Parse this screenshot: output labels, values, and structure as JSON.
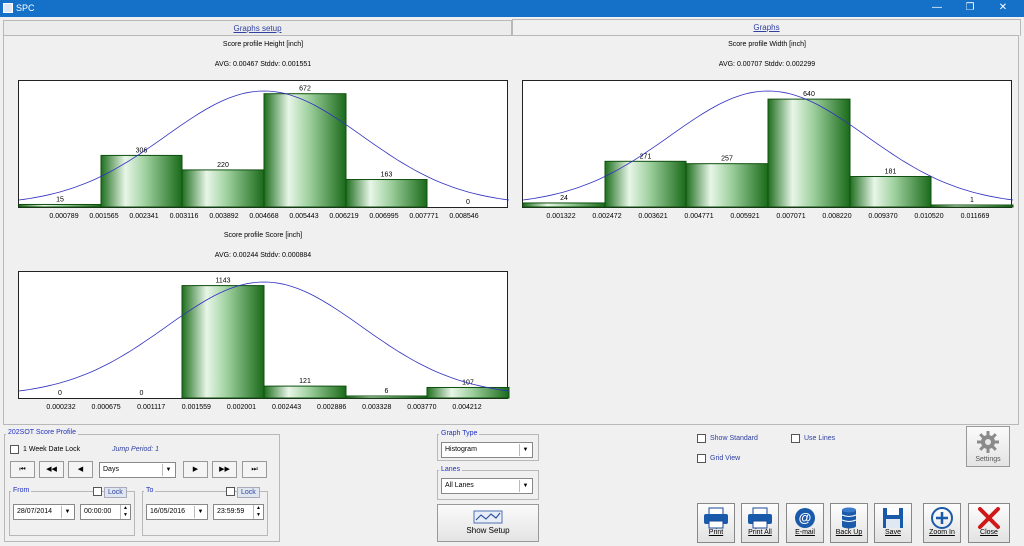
{
  "window": {
    "title": "SPC",
    "minimize": "—",
    "restore": "❐",
    "close": "✕"
  },
  "tabs": [
    {
      "label": "Graphs setup"
    },
    {
      "label": "Graphs"
    }
  ],
  "charts": [
    {
      "title": "Score profile Height  [inch]",
      "stats": "AVG: 0.00467 Stddv: 0.001551"
    },
    {
      "title": "Score profile Width  [inch]",
      "stats": "AVG: 0.00707 Stddv: 0.002299"
    },
    {
      "title": "Score profile Score  [inch]",
      "stats": "AVG: 0.00244 Stddv: 0.000884"
    }
  ],
  "chart_data": [
    {
      "type": "bar",
      "title": "Score profile Height  [inch]",
      "subtitle": "AVG: 0.00467 Stddv: 0.001551",
      "bin_edges": [
        "0.000789",
        "0.001565",
        "0.002341",
        "0.003116",
        "0.003892",
        "0.004668",
        "0.005443",
        "0.006219",
        "0.006995",
        "0.007771",
        "0.008546"
      ],
      "values": [
        15,
        306,
        220,
        672,
        163,
        0
      ],
      "bar_edges": [
        [
          "0.0000",
          "0.001565"
        ],
        [
          "0.001565",
          "0.003116"
        ],
        [
          "0.003116",
          "0.004668"
        ],
        [
          "0.004668",
          "0.006219"
        ],
        [
          "0.006219",
          "0.007771"
        ],
        [
          "0.007771",
          "0.008546"
        ]
      ],
      "normal_curve": {
        "mean": 0.00467,
        "stddev": 0.001551
      },
      "ylim": [
        0,
        700
      ]
    },
    {
      "type": "bar",
      "title": "Score profile Width  [inch]",
      "subtitle": "AVG: 0.00707 Stddv: 0.002299",
      "bin_edges": [
        "0.001322",
        "0.002472",
        "0.003621",
        "0.004771",
        "0.005921",
        "0.007071",
        "0.008220",
        "0.009370",
        "0.010520",
        "0.011669"
      ],
      "values": [
        24,
        271,
        257,
        640,
        181,
        1
      ],
      "normal_curve": {
        "mean": 0.00707,
        "stddev": 0.002299
      },
      "ylim": [
        0,
        700
      ]
    },
    {
      "type": "bar",
      "title": "Score profile Score  [inch]",
      "subtitle": "AVG: 0.00244 Stddv: 0.000884",
      "bin_edges": [
        "0.000232",
        "0.000675",
        "0.001117",
        "0.001559",
        "0.002001",
        "0.002443",
        "0.002886",
        "0.003328",
        "0.003770",
        "0.004212"
      ],
      "values": [
        0,
        0,
        1143,
        121,
        6,
        107
      ],
      "normal_curve": {
        "mean": 0.00244,
        "stddev": 0.000884
      },
      "ylim": [
        0,
        1200
      ]
    }
  ],
  "profile": {
    "title": "202SOT Score Profile",
    "week_lock": "1 Week Date Lock",
    "jump_period": "Jump Period: 1",
    "period": "Days",
    "nav": [
      "⏮",
      "◀◀",
      "◀",
      "▶",
      "▶▶",
      "⏭"
    ],
    "from_label": "From",
    "to_label": "To",
    "lock_label": "Lock",
    "from_date": "28/07/2014",
    "from_time": "00:00:00",
    "to_date": "16/05/2016",
    "to_time": "23:59:59"
  },
  "graph_type": {
    "label": "Graph Type",
    "value": "Histogram"
  },
  "lanes": {
    "label": "Lanes",
    "value": "All Lanes"
  },
  "show_setup": "Show Setup",
  "options": {
    "show_standard": "Show Standard",
    "use_lines": "Use Lines",
    "grid_view": "Grid View"
  },
  "settings": "Settings",
  "toolbar": [
    "Print",
    "Print All",
    "E-mail",
    "Back Up",
    "Save",
    "Zoom In",
    "Close"
  ],
  "colors": {
    "bar": "#1a7a1a",
    "curve": "#3030c0",
    "titlebar": "#1570c8"
  }
}
